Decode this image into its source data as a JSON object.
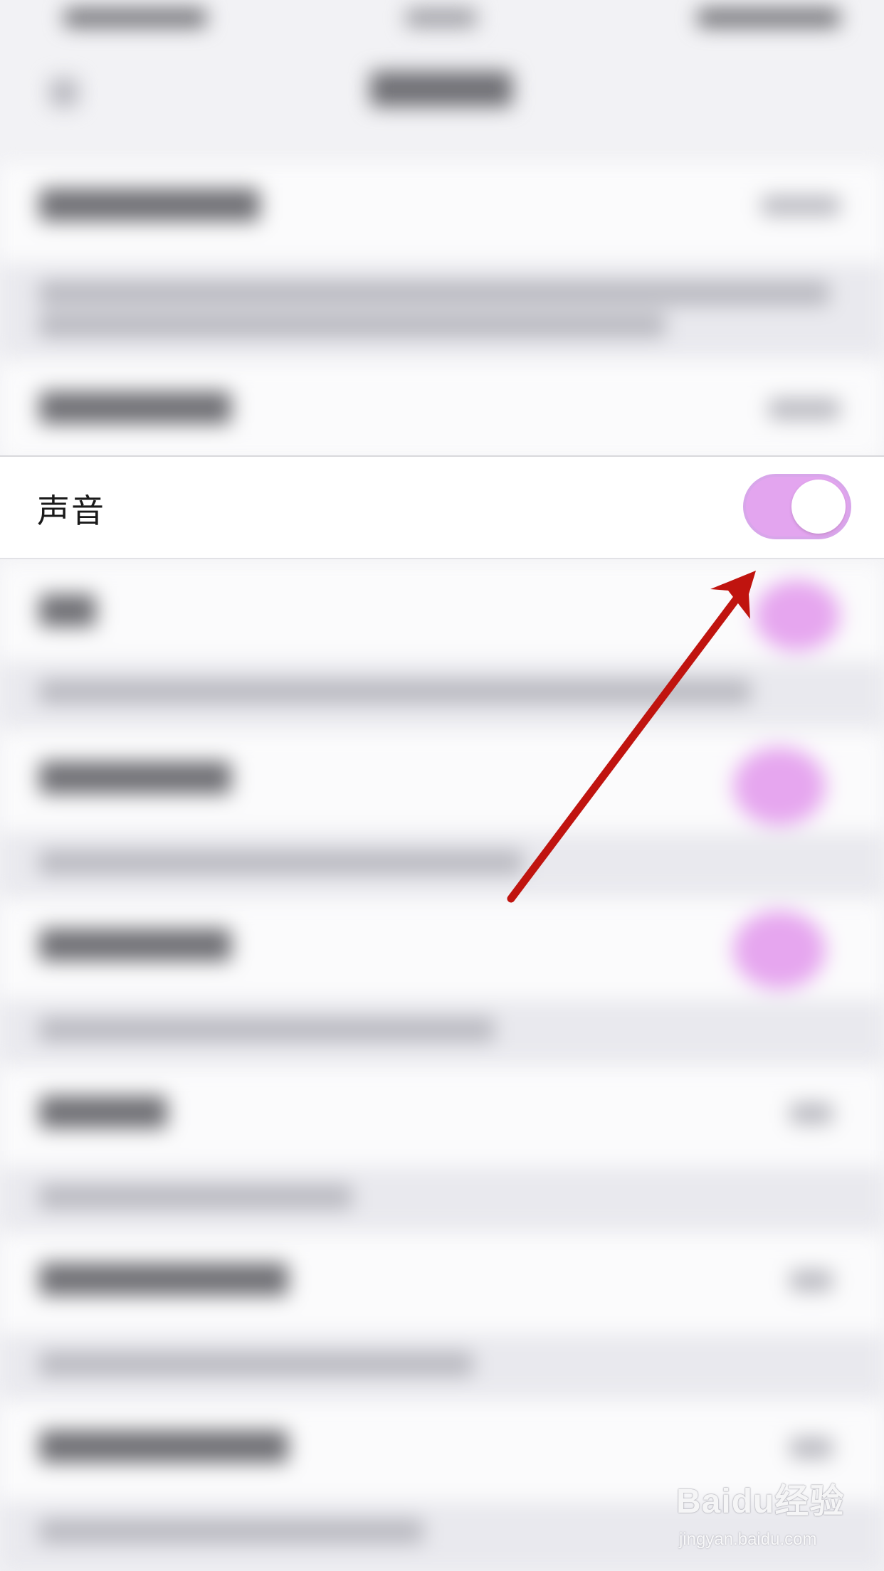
{
  "sound_row": {
    "label": "声音",
    "toggle_on": true,
    "toggle_color": "#e3a5ef"
  },
  "annotation": {
    "arrow_color": "#c0140f"
  },
  "watermark": {
    "logo_text": "Baidu经验",
    "url": "jingyan.baidu.com"
  }
}
